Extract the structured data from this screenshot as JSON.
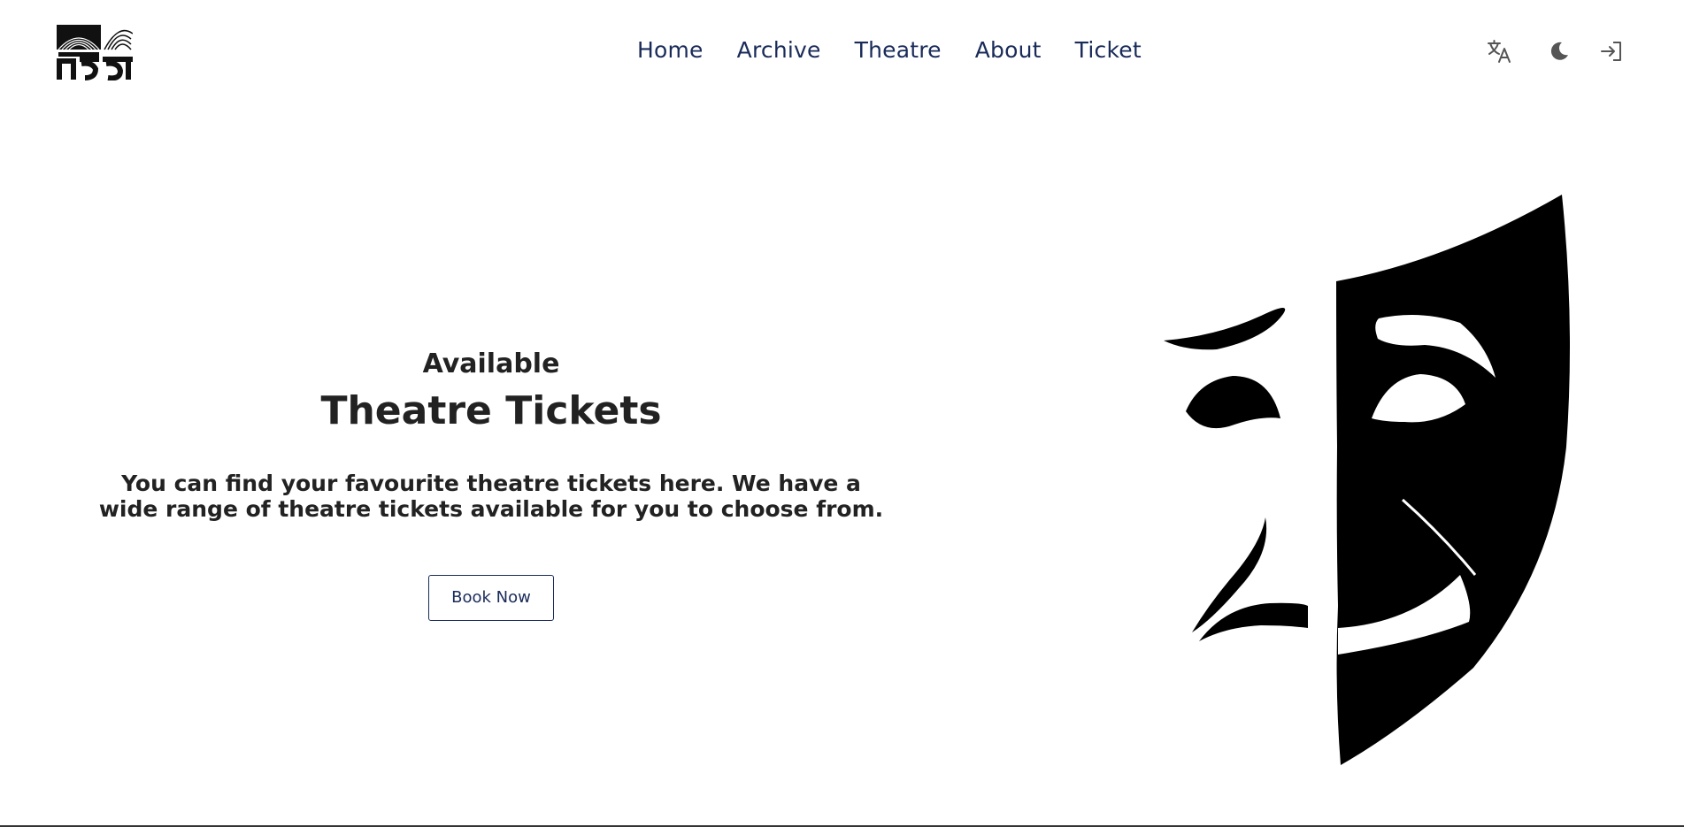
{
  "header": {
    "logo_icon": "natok-logo",
    "logo_text": "নাটক",
    "nav": [
      {
        "label": "Home"
      },
      {
        "label": "Archive"
      },
      {
        "label": "Theatre"
      },
      {
        "label": "About"
      },
      {
        "label": "Ticket"
      }
    ],
    "actions": {
      "translate_icon": "translate-icon",
      "theme_icon": "moon-icon",
      "login_icon": "login-icon"
    }
  },
  "hero": {
    "eyebrow": "Available",
    "headline": "Theatre Tickets",
    "description": "You can find your favourite theatre tickets here. We have a wide range of theatre tickets available for you to choose from.",
    "cta_label": "Book Now",
    "illustration": "theatre-masks-illustration"
  },
  "colors": {
    "nav_text": "#1a2b5a",
    "heading_text": "#222222",
    "background": "#ffffff"
  }
}
